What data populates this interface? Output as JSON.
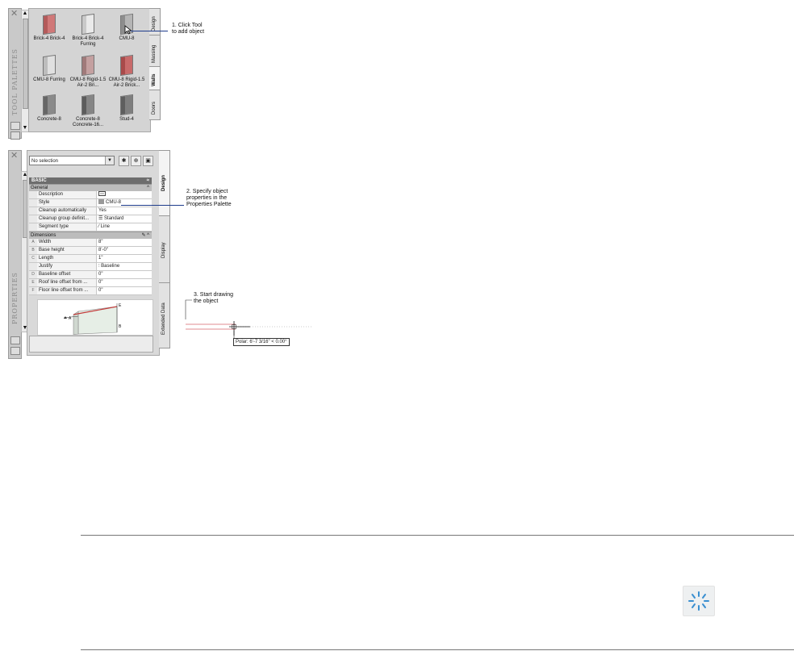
{
  "tool_palette": {
    "strip_title": "TOOL PALETTES",
    "tools": [
      {
        "label": "Brick-4 Brick-4",
        "color": "#b35a5a",
        "face": "#d07878"
      },
      {
        "label": "Brick-4 Brick-4 Furring",
        "color": "#c9c9c9",
        "face": "#eaeaea"
      },
      {
        "label": "CMU-8",
        "color": "#8d8d8d",
        "face": "#b5b5b5"
      },
      {
        "label": "CMU-8 Furring",
        "color": "#bdbdbd",
        "face": "#e0e0e0"
      },
      {
        "label": "CMU-8 Rigid-1.5 Air-2 Bri...",
        "color": "#a07a7a",
        "face": "#c4a0a0"
      },
      {
        "label": "CMU-8 Rigid-1.5 Air-2 Brick...",
        "color": "#a84a4a",
        "face": "#c86a6a"
      },
      {
        "label": "Concrete-8",
        "color": "#666666",
        "face": "#8a8a8a"
      },
      {
        "label": "Concrete-8 Concrete-16...",
        "color": "#5c5c5c",
        "face": "#858585"
      },
      {
        "label": "Stud-4",
        "color": "#5e5e5e",
        "face": "#7e7e7e"
      }
    ],
    "tabs": [
      "Design",
      "Massing",
      "Walls",
      "Doors"
    ],
    "active_tab": "Walls"
  },
  "properties": {
    "strip_title": "PROPERTIES",
    "selection": "No selection",
    "header": "BASIC",
    "general_label": "General",
    "general_rows": [
      {
        "key": "Description",
        "value": "",
        "icon": ""
      },
      {
        "key": "Style",
        "value": "CMU-8",
        "icon": ""
      },
      {
        "key": "Cleanup automatically",
        "value": "Yes",
        "icon": ""
      },
      {
        "key": "Cleanup group definit...",
        "value": "Standard",
        "icon": ""
      },
      {
        "key": "Segment type",
        "value": "Line",
        "icon": ""
      }
    ],
    "dimensions_label": "Dimensions",
    "dimension_rows": [
      {
        "key": "Width",
        "value": "8\"",
        "icon": "A"
      },
      {
        "key": "Base height",
        "value": "8'-0\"",
        "icon": "B"
      },
      {
        "key": "Length",
        "value": "1\"",
        "icon": "C"
      },
      {
        "key": "Justify",
        "value": "Baseline",
        "icon": ""
      },
      {
        "key": "Baseline offset",
        "value": "0\"",
        "icon": "D"
      },
      {
        "key": "Roof line offset from ...",
        "value": "0\"",
        "icon": "E"
      },
      {
        "key": "Floor line offset from ...",
        "value": "0\"",
        "icon": "F"
      }
    ],
    "tabs": [
      "Design",
      "Display",
      "Extended Data"
    ],
    "active_tab": "Design"
  },
  "callouts": {
    "step1": "1. Click Tool\nto add object",
    "step2": "2. Specify object\nproperties in the\nProperties Palette",
    "step3": "3. Start drawing\nthe object"
  },
  "drawing": {
    "tooltip": "Polar: 6'-7 3/16\" < 0.00°"
  },
  "colors": {
    "callout_line": "#1e3c8c",
    "wall_red": "#d8646e"
  }
}
